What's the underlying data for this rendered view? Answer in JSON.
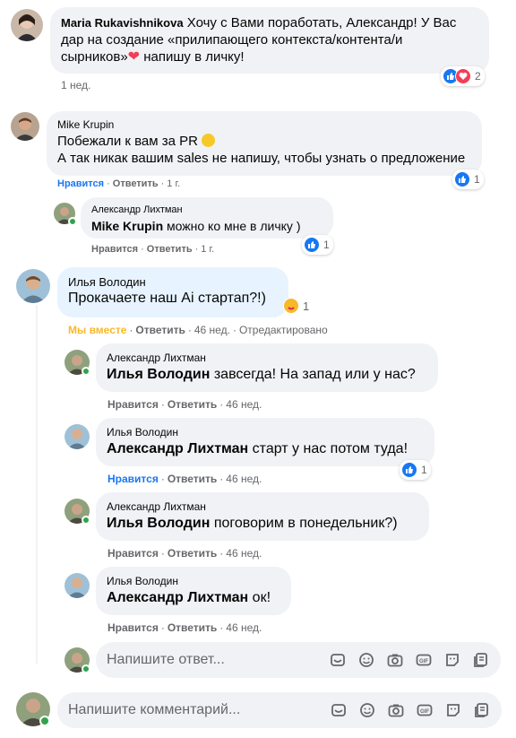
{
  "comments": [
    {
      "author": "Maria Rukavishnikova",
      "text": "Хочу с Вами поработать, Александр! У Вас дар на создание «прилипающего контекста/контента/и сырников»",
      "text_after_emoji": " напишу в личку!",
      "time": "1 нед.",
      "reaction_count": "2"
    },
    {
      "author": "Mike Krupin",
      "line1": "Побежали к вам за PR",
      "line2": "А так никак вашим sales не напишу, чтобы узнать о предложение",
      "like": "Нравится",
      "reply": "Ответить",
      "time": "1 г.",
      "reaction_count": "1"
    },
    {
      "author": "Александр Лихтман",
      "mention": "Mike Krupin",
      "text": " можно ко мне в личку )",
      "like": "Нравится",
      "reply": "Ответить",
      "time": "1 г.",
      "reaction_count": "1"
    },
    {
      "author": "Илья Володин",
      "text": "Прокачаете наш Ai стартап?!)",
      "badge": "Мы вместе",
      "reply": "Ответить",
      "time": "46 нед.",
      "edited": "Отредактировано",
      "reaction_count": "1"
    },
    {
      "author": "Александр Лихтман",
      "mention": "Илья Володин",
      "text": " завсегда! На запад или у нас?",
      "like": "Нравится",
      "reply": "Ответить",
      "time": "46 нед."
    },
    {
      "author": "Илья Володин",
      "mention": "Александр Лихтман",
      "text": " старт у нас потом туда!",
      "like": "Нравится",
      "reply": "Ответить",
      "time": "46 нед.",
      "reaction_count": "1"
    },
    {
      "author": "Александр Лихтман",
      "mention": "Илья Володин",
      "text": " поговорим в понедельник?)",
      "like": "Нравится",
      "reply": "Ответить",
      "time": "46 нед."
    },
    {
      "author": "Илья Володин",
      "mention": "Александр Лихтман",
      "text": " ок!",
      "like": "Нравится",
      "reply": "Ответить",
      "time": "46 нед."
    }
  ],
  "reply_composer": {
    "placeholder": "Напишите ответ..."
  },
  "comment_composer": {
    "placeholder": "Напишите комментарий..."
  },
  "colors": {
    "like_blue": "#1877f2",
    "love_red": "#f33e58",
    "badge_orange": "#f7b928",
    "bubble_gray": "#f0f2f5",
    "bubble_highlight": "#e7f3ff",
    "online_green": "#31a24c"
  },
  "icons": [
    "like-icon",
    "love-icon",
    "heart-emoji-icon",
    "smile-emoji-icon",
    "care-emoji-icon",
    "sticker-icon",
    "emoji-icon",
    "camera-icon",
    "gif-icon",
    "avatar-sticker-icon",
    "notes-icon"
  ]
}
